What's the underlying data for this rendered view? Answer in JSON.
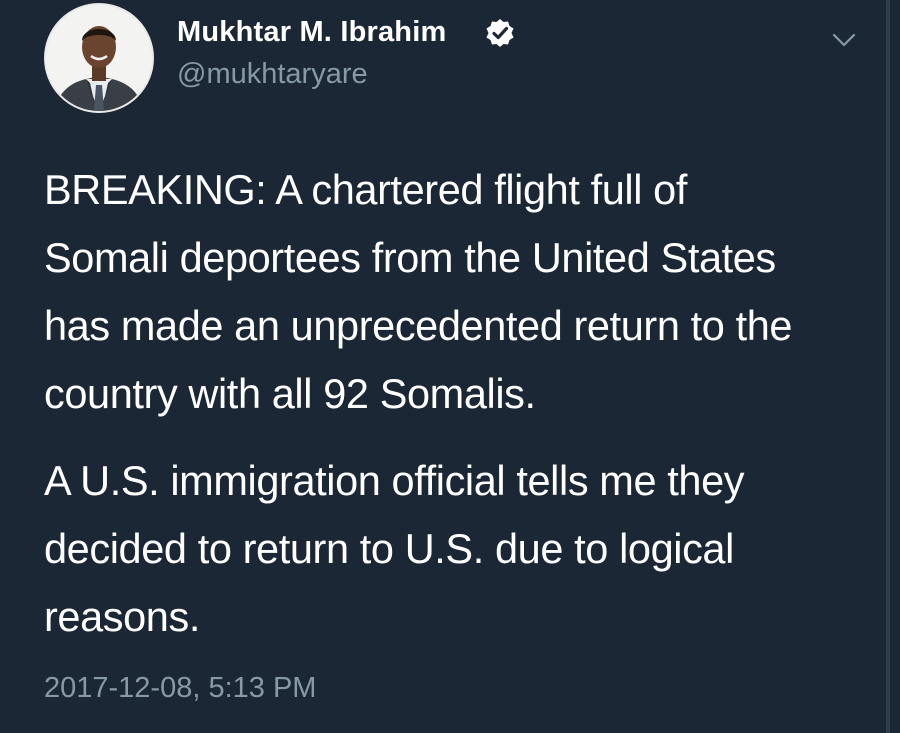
{
  "tweet": {
    "author": {
      "display_name": "Mukhtar M. Ibrahim",
      "handle": "@mukhtaryare",
      "verified": true,
      "avatar_icon": "profile-photo"
    },
    "text": {
      "line1": "BREAKING: A chartered flight full of",
      "line2": "Somali deportees from the United States",
      "line3": "has made an unprecedented return to the",
      "line4": "country with all 92 Somalis.",
      "line5": "A U.S. immigration official tells me they",
      "line6": "decided to return to U.S. due to logical",
      "line7": "reasons."
    },
    "timestamp": "2017-12-08, 5:13 PM",
    "menu_icon": "chevron-down-icon"
  },
  "colors": {
    "background": "#1b2734",
    "primary_text": "#ffffff",
    "secondary_text": "#8899a6",
    "verified_badge": "#ffffff"
  }
}
